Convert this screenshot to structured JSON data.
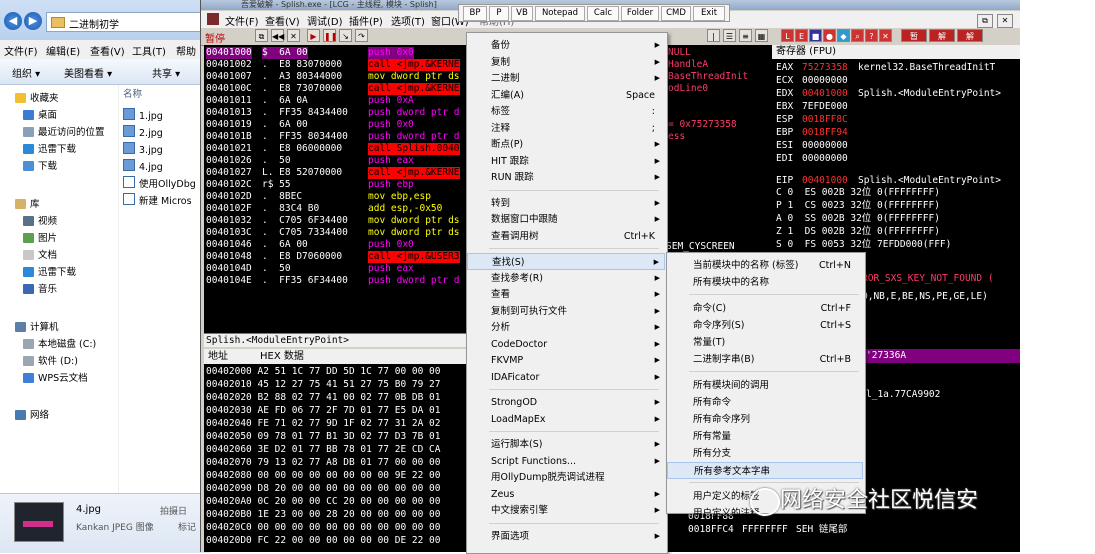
{
  "explorer": {
    "breadcrumb": "二进制初学",
    "menu": [
      "文件(F)",
      "编辑(E)",
      "查看(V)",
      "工具(T)",
      "帮助"
    ],
    "toolbar": [
      "组织 ▾",
      "美图看看 ▾",
      "共享 ▾"
    ],
    "nav": {
      "favorites": "收藏夹",
      "fav_items": [
        "桌面",
        "最近访问的位置",
        "迅雷下载",
        "下载"
      ],
      "library": "库",
      "lib_items": [
        "视频",
        "图片",
        "文档",
        "迅雷下载",
        "音乐"
      ],
      "computer": "计算机",
      "comp_items": [
        "本地磁盘 (C:)",
        "软件 (D:)",
        "WPS云文档"
      ],
      "network": "网络"
    },
    "files_header": "名称",
    "files": [
      "1.jpg",
      "2.jpg",
      "3.jpg",
      "4.jpg",
      "使用OllyDbg",
      "新建 Micros"
    ],
    "details": {
      "name": "4.jpg",
      "type": "Kankan JPEG 图像",
      "date_label": "拍摄日",
      "tag_label": "标记"
    }
  },
  "olly": {
    "title": "吾爱破解 - Splish.exe - [LCG - 主线程, 模块 - Splish]",
    "menu": [
      "文件(F)",
      "查看(V)",
      "调试(D)",
      "插件(P)",
      "选项(T)",
      "窗口(W)",
      "帮助(H)"
    ],
    "pause_label": "暂停",
    "plugin_bar": [
      "BP",
      "P",
      "VB",
      "Notepad",
      "Calc",
      "Folder",
      "CMD",
      "Exit"
    ],
    "cpu_rows": [
      {
        "addr": "00401000",
        "hex": "$  6A 00",
        "dis": "push 0x0",
        "kind": "push",
        "sel": true
      },
      {
        "addr": "00401002",
        "hex": ".  E8 83070000",
        "dis": "call <jmp.&KERNE",
        "kind": "call"
      },
      {
        "addr": "00401007",
        "hex": ".  A3 80344000",
        "dis": "mov dword ptr ds",
        "kind": "mov"
      },
      {
        "addr": "0040100C",
        "hex": ".  E8 73070000",
        "dis": "call <jmp.&KERNE",
        "kind": "call"
      },
      {
        "addr": "00401011",
        "hex": ".  6A 0A",
        "dis": "push 0xA",
        "kind": "push"
      },
      {
        "addr": "00401013",
        "hex": ".  FF35 8434400",
        "dis": "push dword ptr d",
        "kind": "push"
      },
      {
        "addr": "00401019",
        "hex": ".  6A 00",
        "dis": "push 0x0",
        "kind": "push"
      },
      {
        "addr": "0040101B",
        "hex": ".  FF35 8034400",
        "dis": "push dword ptr d",
        "kind": "push"
      },
      {
        "addr": "00401021",
        "hex": ".  E8 06000000",
        "dis": "call Splish.0040",
        "kind": "call"
      },
      {
        "addr": "00401026",
        "hex": ".  50",
        "dis": "push eax",
        "kind": "push"
      },
      {
        "addr": "00401027",
        "hex": "L. E8 52070000",
        "dis": "call <jmp.&KERNE",
        "kind": "call"
      },
      {
        "addr": "0040102C",
        "hex": "r$ 55",
        "dis": "push ebp",
        "kind": "push"
      },
      {
        "addr": "0040102D",
        "hex": ".  8BEC",
        "dis": "mov ebp,esp",
        "kind": "mov"
      },
      {
        "addr": "0040102F",
        "hex": ".  83C4 B0",
        "dis": "add esp,-0x50",
        "kind": "mov"
      },
      {
        "addr": "00401032",
        "hex": ".  C705 6F34400",
        "dis": "mov dword ptr ds",
        "kind": "mov"
      },
      {
        "addr": "0040103C",
        "hex": ".  C705 7334400",
        "dis": "mov dword ptr ds",
        "kind": "mov"
      },
      {
        "addr": "00401046",
        "hex": ".  6A 00",
        "dis": "push 0x0",
        "kind": "push"
      },
      {
        "addr": "00401048",
        "hex": ".  E8 D7060000",
        "dis": "call <jmp.&USER3",
        "kind": "call"
      },
      {
        "addr": "0040104D",
        "hex": ".  50",
        "dis": "push eax",
        "kind": "push"
      },
      {
        "addr": "0040104E",
        "hex": ".  FF35 6F34400",
        "dis": "push dword ptr d",
        "kind": "push"
      }
    ],
    "cpu_status": "Splish.<ModuleEntryPoint>",
    "dump_header": {
      "addr": "地址",
      "hex": "HEX 数据"
    },
    "dump_rows": [
      "00402000 A2 51 1C 77 DD 5D 1C 77 00 00 00",
      "00402010 45 12 27 75 41 51 27 75 B0 79 27",
      "00402020 B2 88 02 77 41 00 02 77 0B DB 01",
      "00402030 AE FD 06 77 2F 7D 01 77 E5 DA 01",
      "00402040 FE 71 02 77 9D 1F 02 77 31 2A 02",
      "00402050 09 78 01 77 B1 3D 02 77 D3 7B 01",
      "00402060 3E D2 01 77 BB 78 01 77 2E CD CA",
      "00402070 79 13 02 77 A8 DB 01 77 00 00 00",
      "00402080 00 00 00 00 00 00 00 00 9E 22 00",
      "00402090 D8 20 00 00 00 00 00 00 00 00 00",
      "004020A0 0C 20 00 00 CC 20 00 00 00 00 00",
      "004020B0 1E 23 00 00 28 20 00 00 00 00 00",
      "004020C0 00 00 00 00 00 00 00 00 00 00 00",
      "004020D0 FC 22 00 00 00 00 00 00 DE 22 00"
    ],
    "info_lines": [
      "NULL",
      "HandleA",
      "BaseThreadInit",
      "odLine0",
      "",
      "",
      "= 0x75273358",
      "ess"
    ],
    "registers_title": "寄存器 (FPU)",
    "registers": [
      {
        "name": "EAX",
        "val": "75273358",
        "info": "kernel32.BaseThreadInitT",
        "red": true
      },
      {
        "name": "ECX",
        "val": "00000000",
        "info": ""
      },
      {
        "name": "EDX",
        "val": "00401000",
        "info": "Splish.<ModuleEntryPoint>",
        "red": true
      },
      {
        "name": "EBX",
        "val": "7EFDE000",
        "info": ""
      },
      {
        "name": "ESP",
        "val": "0018FF8C",
        "info": "",
        "red": true
      },
      {
        "name": "EBP",
        "val": "0018FF94",
        "info": "",
        "red": true
      },
      {
        "name": "ESI",
        "val": "00000000",
        "info": ""
      },
      {
        "name": "EDI",
        "val": "00000000",
        "info": ""
      },
      {
        "name": "EIP",
        "val": "00401000",
        "info": "Splish.<ModuleEntryPoint>",
        "red": true
      }
    ],
    "flags": [
      "C 0  ES 002B 32位 0(FFFFFFFF)",
      "P 1  CS 0023 32位 0(FFFFFFFF)",
      "A 0  SS 002B 32位 0(FFFFFFFF)",
      "Z 1  DS 002B 32位 0(FFFFFFFF)",
      "S 0  FS 0053 32位 7EFDD000(FFF)"
    ],
    "reg_error": "ROR_SXS_KEY_NOT_FOUND (",
    "reg_cond": "O,NB,E,BE,NS,PE,GE,LE)",
    "stack_header": "'27336A",
    "stack_line": "l_1a.77CA9902",
    "stack_rows": [
      {
        "addr": "0018FF88",
        "val": "",
        "info": ""
      },
      {
        "addr": "0018FFC4",
        "val": "FFFFFFFF",
        "info": "SEH 链尾部"
      }
    ],
    "side_text": "SEM_CYSCREEN"
  },
  "context_menu": {
    "items": [
      {
        "label": "备份",
        "arrow": true
      },
      {
        "label": "复制",
        "arrow": true
      },
      {
        "label": "二进制",
        "arrow": true
      },
      {
        "label": "汇编(A)",
        "shortcut": "Space"
      },
      {
        "label": "标签",
        "shortcut": ":"
      },
      {
        "label": "注释",
        "shortcut": ";"
      },
      {
        "label": "断点(P)",
        "arrow": true
      },
      {
        "label": "HIT 跟踪",
        "arrow": true
      },
      {
        "label": "RUN 跟踪",
        "arrow": true
      },
      {
        "sep": true
      },
      {
        "label": "转到",
        "arrow": true
      },
      {
        "label": "数据窗口中跟随",
        "arrow": true
      },
      {
        "label": "查看调用树",
        "shortcut": "Ctrl+K"
      },
      {
        "sep": true
      },
      {
        "label": "查找(S)",
        "arrow": true,
        "active": true
      },
      {
        "label": "查找参考(R)",
        "arrow": true
      },
      {
        "label": "查看",
        "arrow": true
      },
      {
        "label": "复制到可执行文件",
        "arrow": true
      },
      {
        "label": "分析",
        "arrow": true
      },
      {
        "label": "CodeDoctor",
        "arrow": true
      },
      {
        "label": "FKVMP",
        "arrow": true
      },
      {
        "label": "IDAFicator",
        "arrow": true
      },
      {
        "sep": true
      },
      {
        "label": "StrongOD",
        "arrow": true
      },
      {
        "label": "LoadMapEx",
        "arrow": true
      },
      {
        "sep": true
      },
      {
        "label": "运行脚本(S)",
        "arrow": true
      },
      {
        "label": "Script Functions...",
        "arrow": true
      },
      {
        "label": "用OllyDump脱壳调试进程"
      },
      {
        "label": "Zeus",
        "arrow": true
      },
      {
        "label": "中文搜索引擎",
        "arrow": true
      },
      {
        "sep": true
      },
      {
        "label": "界面选项",
        "arrow": true
      }
    ]
  },
  "submenu": {
    "items": [
      {
        "label": "当前模块中的名称 (标签)",
        "shortcut": "Ctrl+N"
      },
      {
        "label": "所有模块中的名称"
      },
      {
        "sep": true
      },
      {
        "label": "命令(C)",
        "shortcut": "Ctrl+F"
      },
      {
        "label": "命令序列(S)",
        "shortcut": "Ctrl+S"
      },
      {
        "label": "常量(T)"
      },
      {
        "label": "二进制字串(B)",
        "shortcut": "Ctrl+B"
      },
      {
        "sep": true
      },
      {
        "label": "所有模块间的调用"
      },
      {
        "label": "所有命令"
      },
      {
        "label": "所有命令序列"
      },
      {
        "label": "所有常量"
      },
      {
        "label": "所有分支"
      },
      {
        "label": "所有参考文本字串",
        "active": true
      },
      {
        "sep": true
      },
      {
        "label": "用户定义的标签"
      },
      {
        "label": "用户定义的注释"
      }
    ]
  },
  "watermark": "网络安全社区悦信安"
}
